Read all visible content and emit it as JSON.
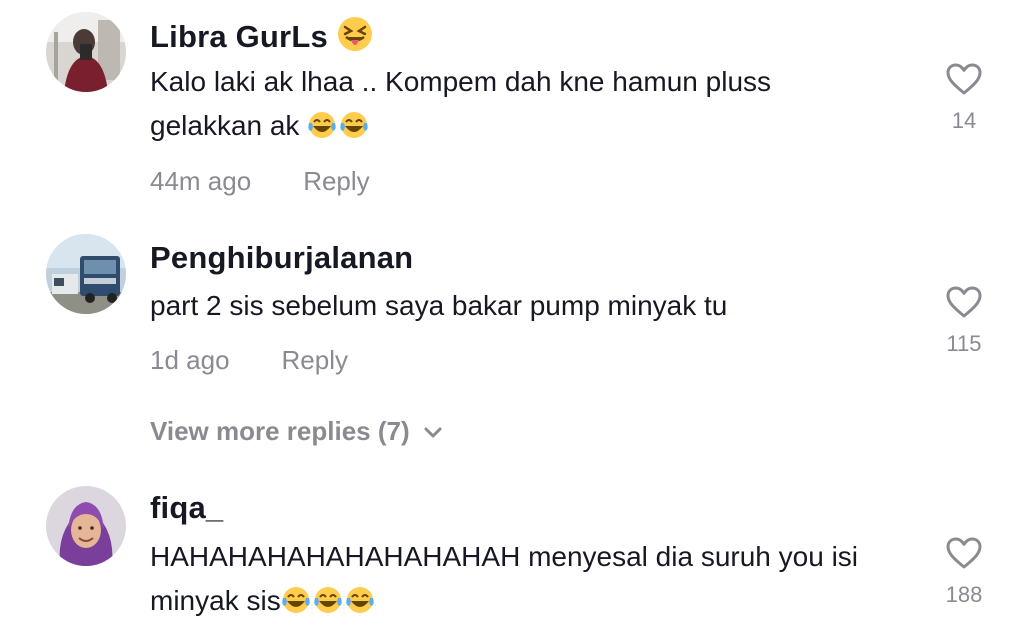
{
  "comments": [
    {
      "username": "Libra GurLs",
      "text": "Kalo laki ak lhaa .. Kompem dah kne hamun pluss gelakkan ak",
      "time": "44m ago",
      "reply_label": "Reply",
      "likes": "14"
    },
    {
      "username": "Penghiburjalanan",
      "text": "part 2 sis sebelum saya bakar pump minyak tu",
      "time": "1d ago",
      "reply_label": "Reply",
      "likes": "115"
    },
    {
      "username": "fiqa_",
      "text": "HAHAHAHAHAHAHAHAHAH menyesal dia suruh you isi minyak sis",
      "likes": "188"
    }
  ],
  "view_more_replies": "View more replies (7)",
  "colors": {
    "primary_text": "#161823",
    "secondary_text": "#8a8b91",
    "background": "#ffffff"
  }
}
